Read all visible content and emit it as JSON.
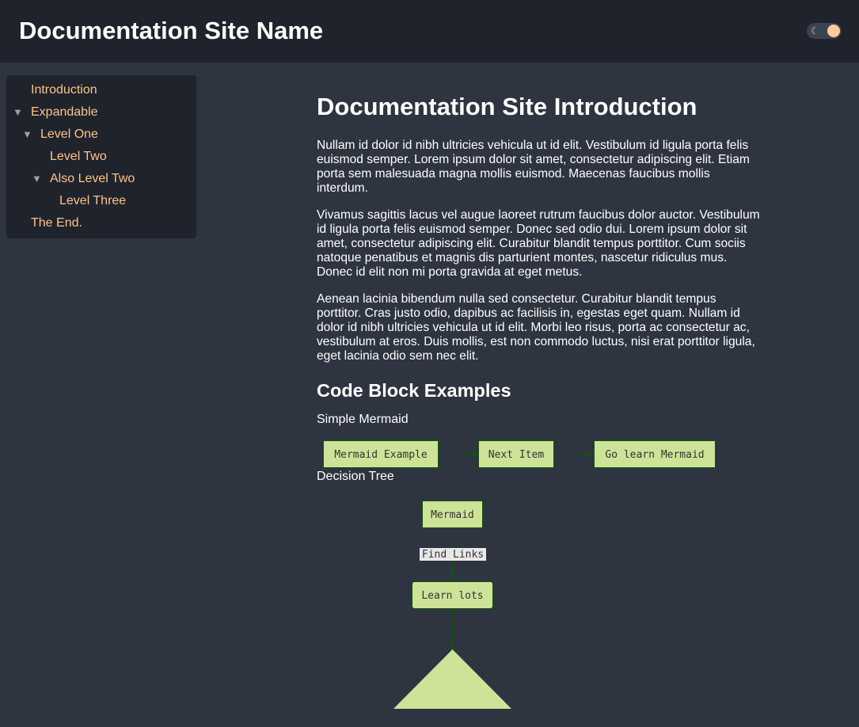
{
  "header": {
    "site_title": "Documentation Site Name",
    "theme_toggle_icon": "moon-icon"
  },
  "sidebar": {
    "items": [
      {
        "label": "Introduction",
        "expanded": null
      },
      {
        "label": "Expandable",
        "expanded": true
      },
      {
        "label": "Level One",
        "expanded": true
      },
      {
        "label": "Level Two",
        "expanded": null
      },
      {
        "label": "Also Level Two",
        "expanded": true
      },
      {
        "label": "Level Three",
        "expanded": null
      },
      {
        "label": "The End.",
        "expanded": null
      }
    ],
    "expand_glyph": "▼"
  },
  "main": {
    "title": "Documentation Site Introduction",
    "paragraphs": [
      "Nullam id dolor id nibh ultricies vehicula ut id elit. Vestibulum id ligula porta felis euismod semper. Lorem ipsum dolor sit amet, consectetur adipiscing elit. Etiam porta sem malesuada magna mollis euismod. Maecenas faucibus mollis interdum.",
      "Vivamus sagittis lacus vel augue laoreet rutrum faucibus dolor auctor. Vestibulum id ligula porta felis euismod semper. Donec sed odio dui. Lorem ipsum dolor sit amet, consectetur adipiscing elit. Curabitur blandit tempus porttitor. Cum sociis natoque penatibus et magnis dis parturient montes, nascetur ridiculus mus. Donec id elit non mi porta gravida at eget metus.",
      "Aenean lacinia bibendum nulla sed consectetur. Curabitur blandit tempus porttitor. Cras justo odio, dapibus ac facilisis in, egestas eget quam. Nullam id dolor id nibh ultricies vehicula ut id elit. Morbi leo risus, porta ac consectetur ac, vestibulum at eros. Duis mollis, est non commodo luctus, nisi erat porttitor ligula, eget lacinia odio sem nec elit."
    ],
    "code_section_title": "Code Block Examples",
    "simple_caption": "Simple Mermaid",
    "simple_nodes": [
      "Mermaid Example",
      "Next Item",
      "Go learn Mermaid"
    ],
    "tree_caption": "Decision Tree",
    "tree_root": "Mermaid",
    "tree_edge_label": "Find Links",
    "tree_child": "Learn lots"
  },
  "colors": {
    "page_bg": "#2e3440",
    "header_bg": "#1f232b",
    "link": "#ffc38a",
    "node_fill": "#cde498",
    "node_stroke": "#13540c",
    "edge": "#13540c"
  }
}
